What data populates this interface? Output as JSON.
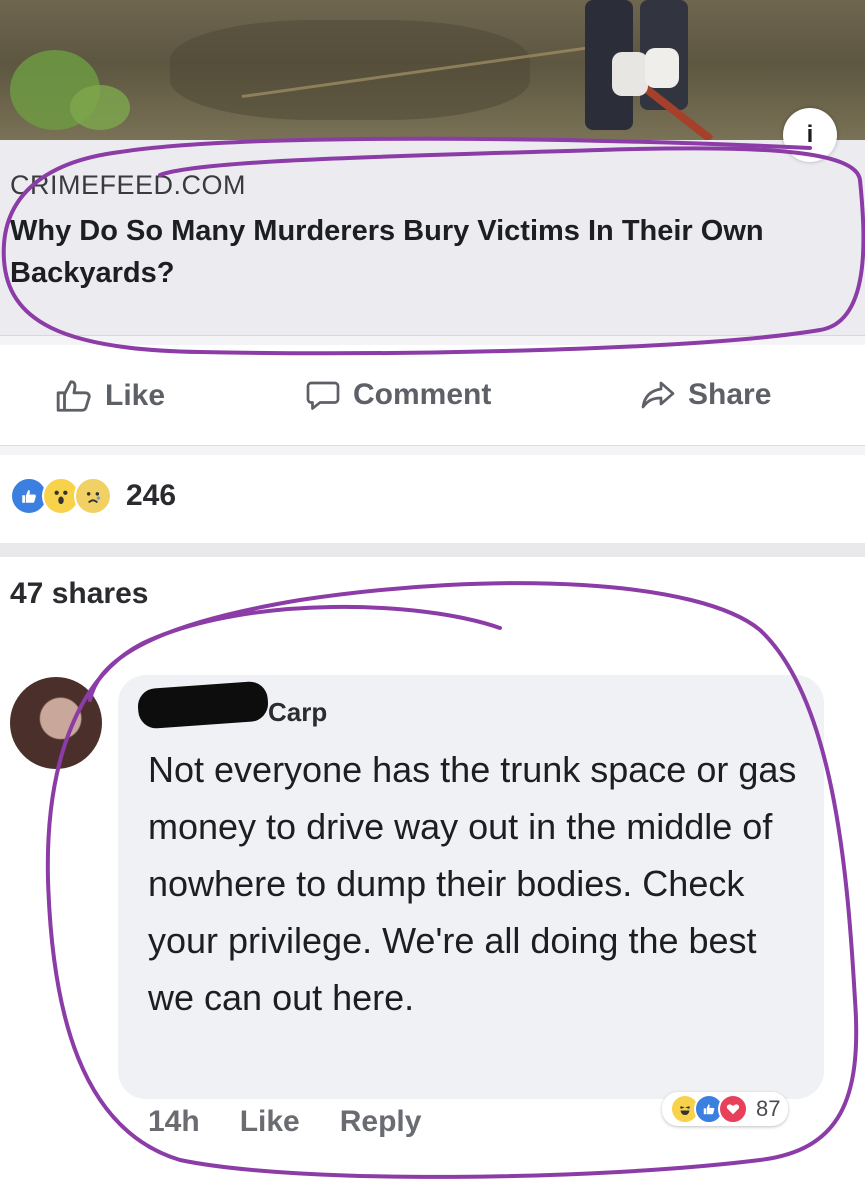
{
  "post": {
    "link_source": "CRIMEFEED.COM",
    "headline": "Why Do So Many Murderers Bury Victims In Their Own Backyards?",
    "info_icon": "info-icon",
    "info_glyph": "i"
  },
  "actions": {
    "like_label": "Like",
    "comment_label": "Comment",
    "share_label": "Share"
  },
  "reactions": {
    "count": "246",
    "types": [
      "like",
      "wow",
      "sad"
    ]
  },
  "shares_label": "47 shares",
  "comment": {
    "author": "Carp",
    "text": "Not everyone has the trunk space or gas money to drive way out in the middle of nowhere to dump their bodies. Check your privilege. We're all doing the best we can out here.",
    "time": "14h",
    "like_label": "Like",
    "reply_label": "Reply",
    "reaction_count": "87",
    "reaction_types": [
      "haha",
      "like",
      "love"
    ]
  },
  "colors": {
    "annotation": "#8b3ca6",
    "like_blue": "#3b7fe0"
  }
}
